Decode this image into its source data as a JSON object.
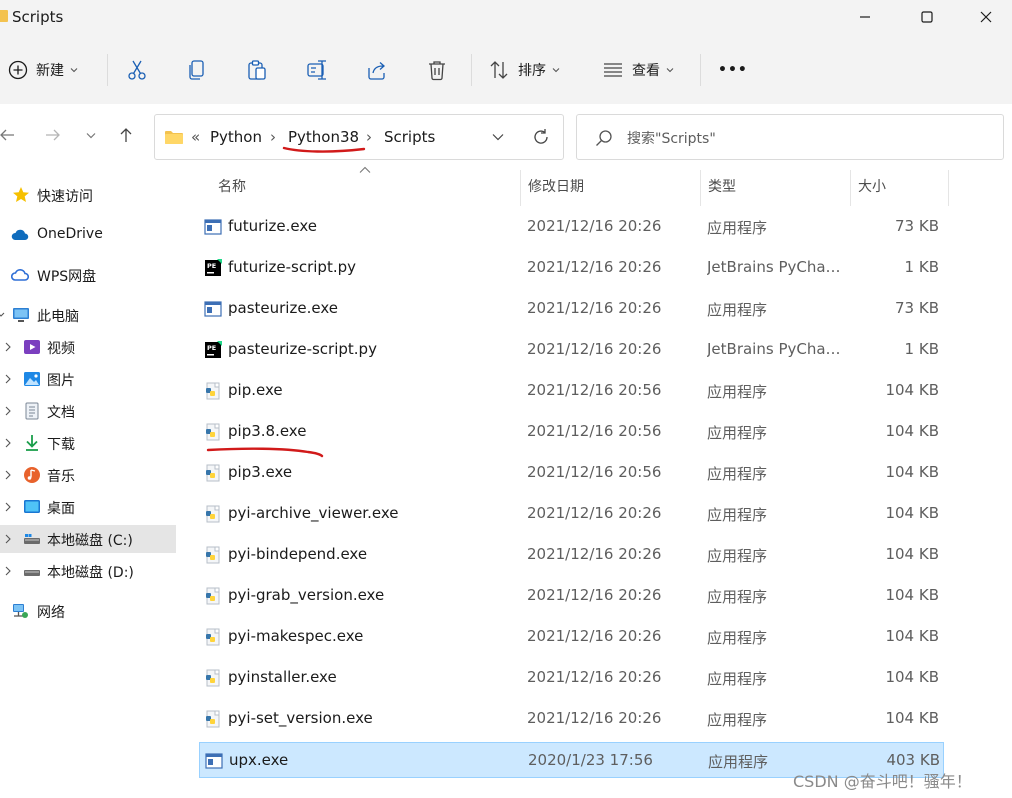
{
  "window": {
    "title": "Scripts",
    "minimize_label": "Minimize",
    "maximize_label": "Maximize",
    "close_label": "Close"
  },
  "toolbar": {
    "new_label": "新建",
    "sort_label": "排序",
    "view_label": "查看",
    "more_label": "•••"
  },
  "address": {
    "overflow": "«",
    "crumbs": [
      "Python",
      "Python38",
      "Scripts"
    ],
    "separator": "›"
  },
  "search": {
    "placeholder": "搜索\"Scripts\""
  },
  "sidebar": {
    "items": [
      {
        "label": "快速访问",
        "icon": "star-icon"
      },
      {
        "label": "OneDrive",
        "icon": "cloud-icon"
      },
      {
        "label": "WPS网盘",
        "icon": "wps-cloud-icon"
      },
      {
        "label": "此电脑",
        "icon": "computer-icon"
      },
      {
        "label": "视频",
        "icon": "video-icon"
      },
      {
        "label": "图片",
        "icon": "picture-icon"
      },
      {
        "label": "文档",
        "icon": "document-icon"
      },
      {
        "label": "下载",
        "icon": "download-icon"
      },
      {
        "label": "音乐",
        "icon": "music-icon"
      },
      {
        "label": "桌面",
        "icon": "desktop-icon"
      },
      {
        "label": "本地磁盘 (C:)",
        "icon": "drive-icon"
      },
      {
        "label": "本地磁盘 (D:)",
        "icon": "drive-icon"
      },
      {
        "label": "网络",
        "icon": "network-icon"
      }
    ],
    "selected_index": 10
  },
  "columns": {
    "name": "名称",
    "date": "修改日期",
    "type": "类型",
    "size": "大小"
  },
  "files": [
    {
      "name": "futurize.exe",
      "date": "2021/12/16 20:26",
      "type": "应用程序",
      "size": "73 KB",
      "icon": "exe-window-icon"
    },
    {
      "name": "futurize-script.py",
      "date": "2021/12/16 20:26",
      "type": "JetBrains PyCharm",
      "size": "1 KB",
      "icon": "pycharm-file-icon"
    },
    {
      "name": "pasteurize.exe",
      "date": "2021/12/16 20:26",
      "type": "应用程序",
      "size": "73 KB",
      "icon": "exe-window-icon"
    },
    {
      "name": "pasteurize-script.py",
      "date": "2021/12/16 20:26",
      "type": "JetBrains PyCharm",
      "size": "1 KB",
      "icon": "pycharm-file-icon"
    },
    {
      "name": "pip.exe",
      "date": "2021/12/16 20:56",
      "type": "应用程序",
      "size": "104 KB",
      "icon": "python-exe-icon"
    },
    {
      "name": "pip3.8.exe",
      "date": "2021/12/16 20:56",
      "type": "应用程序",
      "size": "104 KB",
      "icon": "python-exe-icon"
    },
    {
      "name": "pip3.exe",
      "date": "2021/12/16 20:56",
      "type": "应用程序",
      "size": "104 KB",
      "icon": "python-exe-icon"
    },
    {
      "name": "pyi-archive_viewer.exe",
      "date": "2021/12/16 20:26",
      "type": "应用程序",
      "size": "104 KB",
      "icon": "python-exe-icon"
    },
    {
      "name": "pyi-bindepend.exe",
      "date": "2021/12/16 20:26",
      "type": "应用程序",
      "size": "104 KB",
      "icon": "python-exe-icon"
    },
    {
      "name": "pyi-grab_version.exe",
      "date": "2021/12/16 20:26",
      "type": "应用程序",
      "size": "104 KB",
      "icon": "python-exe-icon"
    },
    {
      "name": "pyi-makespec.exe",
      "date": "2021/12/16 20:26",
      "type": "应用程序",
      "size": "104 KB",
      "icon": "python-exe-icon"
    },
    {
      "name": "pyinstaller.exe",
      "date": "2021/12/16 20:26",
      "type": "应用程序",
      "size": "104 KB",
      "icon": "python-exe-icon"
    },
    {
      "name": "pyi-set_version.exe",
      "date": "2021/12/16 20:26",
      "type": "应用程序",
      "size": "104 KB",
      "icon": "python-exe-icon"
    },
    {
      "name": "upx.exe",
      "date": "2020/1/23 17:56",
      "type": "应用程序",
      "size": "403 KB",
      "icon": "exe-window-icon"
    }
  ],
  "selected_file_index": 13,
  "watermark": "CSDN @奋斗吧！骚年！",
  "colors": {
    "accent": "#0067c0",
    "selection": "#cce8ff",
    "annotation": "#d11a1a"
  }
}
